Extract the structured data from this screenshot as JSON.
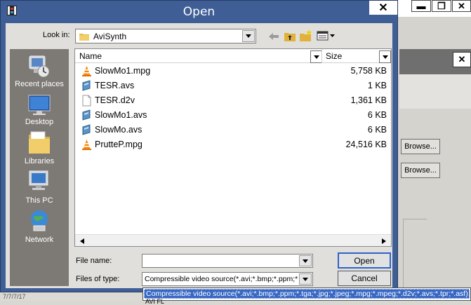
{
  "dialog": {
    "title": "Open",
    "close_label": "✕",
    "look_in_label": "Look in:",
    "look_in_value": "AviSynth",
    "file_name_label": "File name:",
    "file_name_value": "",
    "files_of_type_label": "Files of type:",
    "files_of_type_value": "Compressible video source(*.avi;*.bmp;*.ppm;*.t",
    "open_button": "Open",
    "cancel_button": "Cancel"
  },
  "places": [
    {
      "label": "Recent places",
      "icon": "recent-places-icon"
    },
    {
      "label": "Desktop",
      "icon": "desktop-icon"
    },
    {
      "label": "Libraries",
      "icon": "libraries-icon"
    },
    {
      "label": "This PC",
      "icon": "this-pc-icon"
    },
    {
      "label": "Network",
      "icon": "network-icon"
    }
  ],
  "columns": {
    "name": "Name",
    "size": "Size"
  },
  "files": [
    {
      "name": "SlowMo1.mpg",
      "size": "5,758 KB",
      "icon": "vlc-cone-icon"
    },
    {
      "name": "TESR.avs",
      "size": "1 KB",
      "icon": "avs-script-icon"
    },
    {
      "name": "TESR.d2v",
      "size": "1,361 KB",
      "icon": "blank-file-icon"
    },
    {
      "name": "SlowMo1.avs",
      "size": "6 KB",
      "icon": "avs-script-icon"
    },
    {
      "name": "SlowMo.avs",
      "size": "6 KB",
      "icon": "avs-script-icon"
    },
    {
      "name": "PrutteP.mpg",
      "size": "24,516 KB",
      "icon": "vlc-cone-icon"
    }
  ],
  "type_dropdown": {
    "selected_option": "Compressible video source(*.avi;*.bmp;*.ppm;*.tga;*.jpg;*.jpeg;*.mpg;*.mpeg;*.d2v;*.avs;*.tpr;*.asf)",
    "next_option": "AVI FL"
  },
  "background_app": {
    "minimize_label": "▬",
    "maximize_label": "❐",
    "close_label": "✕",
    "sub_close_label": "✕",
    "browse_1": "Browse...",
    "browse_2": "Browse...",
    "status_text": "7/7/7/17"
  },
  "colors": {
    "title_bar": "#3f5e95",
    "selection": "#3868c4",
    "places_bar": "#7d7a76"
  }
}
